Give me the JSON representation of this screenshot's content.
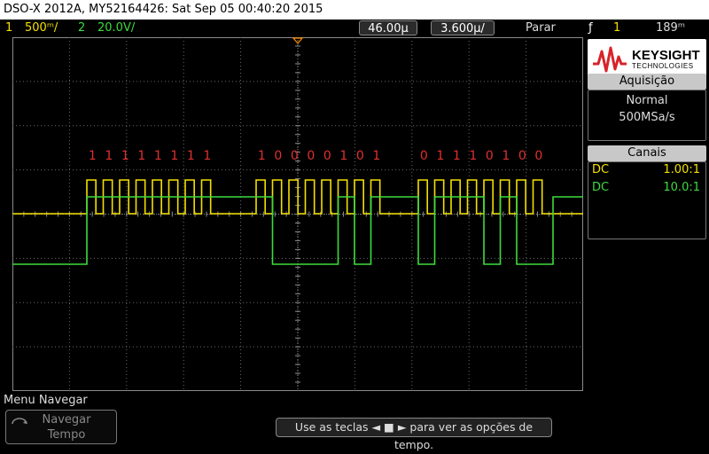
{
  "title_bar": {
    "text": "DSO-X 2012A, MY52164426: Sat Sep 05 00:40:20 2015"
  },
  "status_bar": {
    "ch1_num": "1",
    "ch1_scale": "500ᵐ/",
    "ch2_num": "2",
    "ch2_scale": "20.0V/",
    "time_delay": "46.00µ",
    "time_scale": "3.600µ/",
    "run_state": "Parar",
    "trigger_source": "1",
    "trigger_level": "189ᵐ"
  },
  "brand": {
    "name": "KEYSIGHT",
    "sub": "TECHNOLOGIES"
  },
  "acquisition": {
    "title": "Aquisição",
    "mode": "Normal",
    "sample_rate": "500MSa/s"
  },
  "channels_panel": {
    "title": "Canais",
    "rows": [
      {
        "coupling": "DC",
        "probe": "1.00:1",
        "color": "#f4e000"
      },
      {
        "coupling": "DC",
        "probe": "10.0:1",
        "color": "#3cdc3c"
      }
    ]
  },
  "decode_bits": [
    [
      "1",
      "1",
      "1",
      "1",
      "1",
      "1",
      "1",
      "1"
    ],
    [
      "1",
      "0",
      "0",
      "0",
      "0",
      "1",
      "0",
      "1"
    ],
    [
      "0",
      "1",
      "1",
      "1",
      "0",
      "1",
      "0",
      "0"
    ]
  ],
  "markers": {
    "trigger_T": "T",
    "ch1": "1",
    "ch2": "2"
  },
  "menu": {
    "label": "Menu Navegar",
    "softkey1": "Navegar Tempo"
  },
  "hint": "Use as teclas ◄ ■ ► para ver as opções de tempo.",
  "colors": {
    "ch1": "#f4e000",
    "ch2": "#3cdc3c",
    "grid": "#6a6a6a",
    "bits": "#e03030",
    "trigger": "#ff8c00"
  }
}
